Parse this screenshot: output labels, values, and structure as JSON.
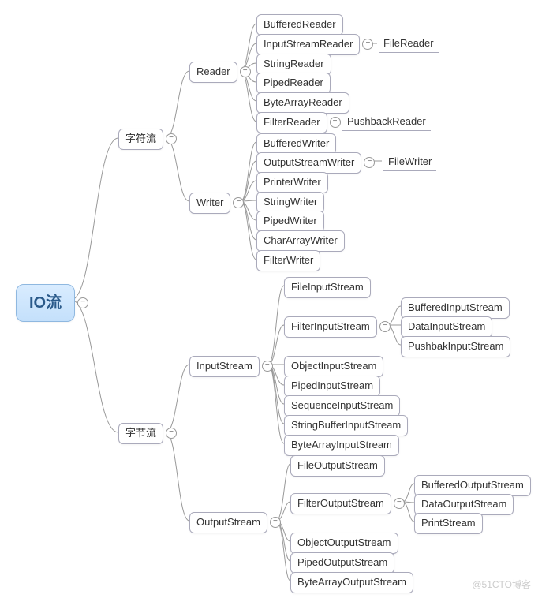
{
  "root": "IO流",
  "watermark": "@51CTO博客",
  "l1": {
    "char": "字符流",
    "byte": "字节流"
  },
  "reader": {
    "label": "Reader",
    "children": [
      "BufferedReader",
      "InputStreamReader",
      "StringReader",
      "PipedReader",
      "ByteArrayReader",
      "FilterReader"
    ],
    "isr_child": "FileReader",
    "fr_child": "PushbackReader"
  },
  "writer": {
    "label": "Writer",
    "children": [
      "BufferedWriter",
      "OutputStreamWriter",
      "PrinterWriter",
      "StringWriter",
      "PipedWriter",
      "CharArrayWriter",
      "FilterWriter"
    ],
    "osw_child": "FileWriter"
  },
  "input": {
    "label": "InputStream",
    "children": [
      "FileInputStream",
      "FilterInputStream",
      "ObjectInputStream",
      "PipedInputStream",
      "SequenceInputStream",
      "StringBufferInputStream",
      "ByteArrayInputStream"
    ],
    "fis_children": [
      "BufferedInputStream",
      "DataInputStream",
      "PushbakInputStream"
    ]
  },
  "output": {
    "label": "OutputStream",
    "children": [
      "FileOutputStream",
      "FilterOutputStream",
      "ObjectOutputStream",
      "PipedOutputStream",
      "ByteArrayOutputStream"
    ],
    "fos_children": [
      "BufferedOutputStream",
      "DataOutputStream",
      "PrintStream"
    ]
  }
}
